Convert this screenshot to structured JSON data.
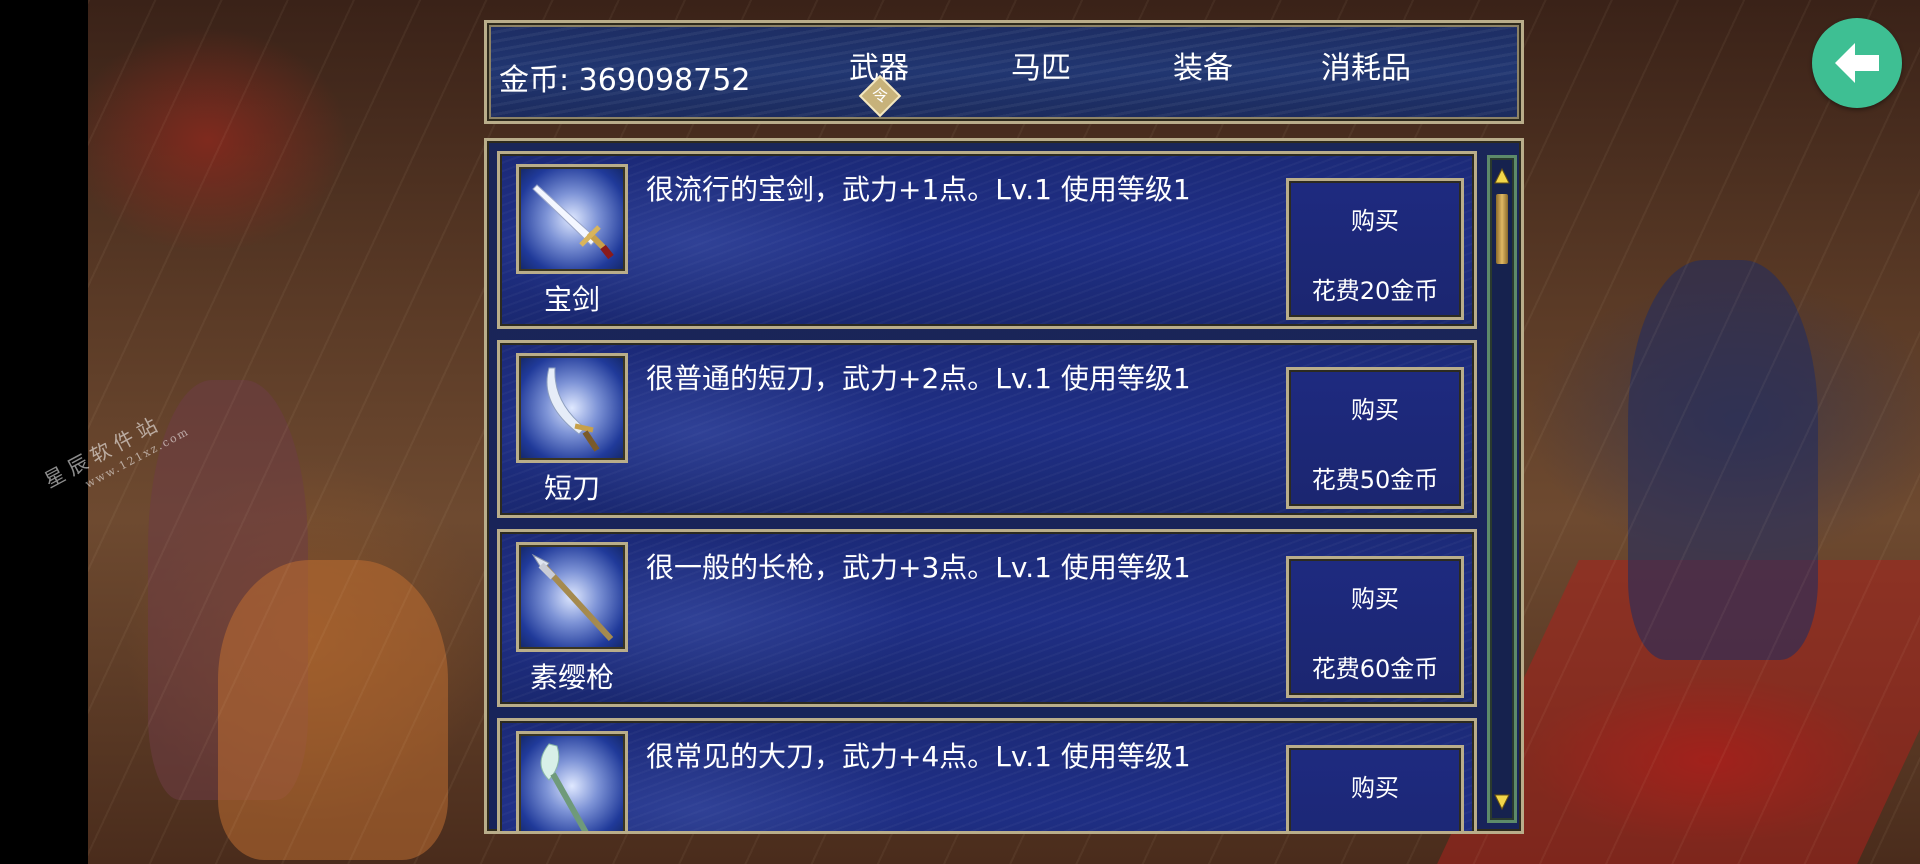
{
  "header": {
    "gold_label": "金币: 369098752",
    "tabs": [
      {
        "label": "武器",
        "selected": true
      },
      {
        "label": "马匹",
        "selected": false
      },
      {
        "label": "装备",
        "selected": false
      },
      {
        "label": "消耗品",
        "selected": false
      }
    ],
    "tab_indicator_glyph": "令"
  },
  "back_button": {
    "icon": "arrow-left-icon",
    "color": "#3ebf93"
  },
  "watermark": {
    "line1": "星辰软件站",
    "line2": "www.121xz.com"
  },
  "items": [
    {
      "name": "宝剑",
      "icon": "sword-icon",
      "desc": "很流行的宝剑，武力+1点。Lv.1 使用等级1",
      "buy_label": "购买",
      "cost": "花费20金币"
    },
    {
      "name": "短刀",
      "icon": "saber-icon",
      "desc": "很普通的短刀，武力+2点。Lv.1 使用等级1",
      "buy_label": "购买",
      "cost": "花费50金币"
    },
    {
      "name": "素缨枪",
      "icon": "spear-icon",
      "desc": "很一般的长枪，武力+3点。Lv.1 使用等级1",
      "buy_label": "购买",
      "cost": "花费60金币"
    },
    {
      "name": "",
      "icon": "glaive-icon",
      "desc": "很常见的大刀，武力+4点。Lv.1 使用等级1",
      "buy_label": "购买",
      "cost": ""
    }
  ],
  "colors": {
    "panel_border": "#b9ad8a",
    "panel_bg": "#1f2f86",
    "accent_green": "#3ebf93"
  }
}
